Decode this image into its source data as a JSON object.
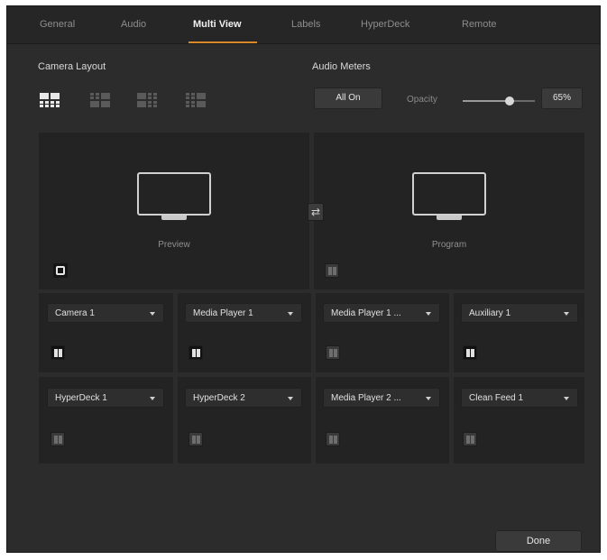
{
  "tabs": [
    {
      "label": "General"
    },
    {
      "label": "Audio"
    },
    {
      "label": "Multi View"
    },
    {
      "label": "Labels"
    },
    {
      "label": "HyperDeck"
    },
    {
      "label": "Remote"
    }
  ],
  "active_tab": "Multi View",
  "camera_layout": {
    "label": "Camera Layout",
    "icons": [
      "layout-1-icon",
      "layout-2-icon",
      "layout-3-icon",
      "layout-4-icon"
    ],
    "selected_index": 0
  },
  "audio_meters": {
    "label": "Audio Meters",
    "all_on_label": "All On",
    "opacity_label": "Opacity",
    "opacity_value": 0.65,
    "opacity_text": "65%"
  },
  "preview": {
    "label": "Preview"
  },
  "program": {
    "label": "Program"
  },
  "sources": [
    {
      "value": "Camera 1",
      "meter_on": true
    },
    {
      "value": "Media Player 1",
      "meter_on": true
    },
    {
      "value": "Media Player 1 ...",
      "meter_on": false
    },
    {
      "value": "Auxiliary 1",
      "meter_on": true
    },
    {
      "value": "HyperDeck 1",
      "meter_on": false
    },
    {
      "value": "HyperDeck 2",
      "meter_on": false
    },
    {
      "value": "Media Player 2 ...",
      "meter_on": false
    },
    {
      "value": "Clean Feed 1",
      "meter_on": false
    }
  ],
  "done_label": "Done",
  "colors": {
    "accent": "#d88a2a",
    "background": "#2c2c2c",
    "panel": "#232323"
  }
}
